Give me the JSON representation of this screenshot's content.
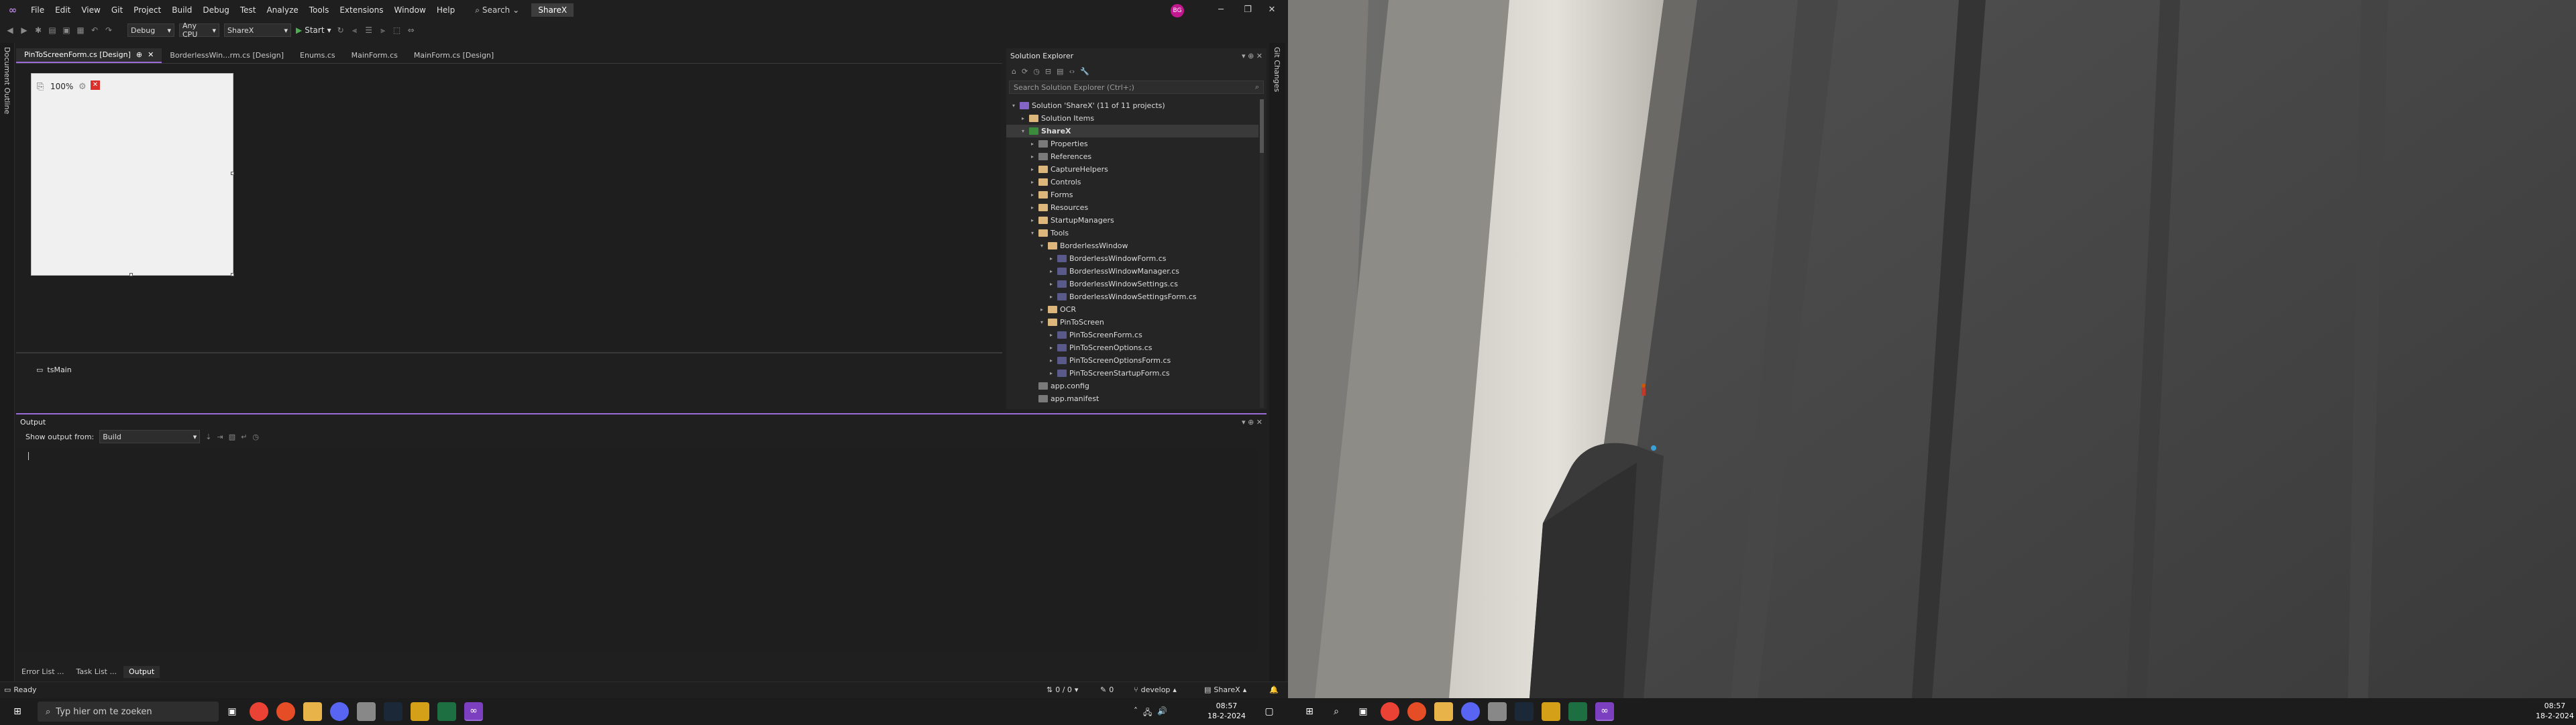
{
  "menubar": {
    "logo": "VS",
    "items": [
      "File",
      "Edit",
      "View",
      "Git",
      "Project",
      "Build",
      "Debug",
      "Test",
      "Analyze",
      "Tools",
      "Extensions",
      "Window",
      "Help"
    ],
    "search_label": "Search",
    "solution_name": "ShareX",
    "avatar_initials": "BG"
  },
  "toolbar": {
    "configuration": "Debug",
    "platform": "Any CPU",
    "startup_project": "ShareX",
    "start_label": "Start"
  },
  "left_strip": {
    "label": "Document Outline"
  },
  "right_strip": {
    "label": "Git Changes"
  },
  "doc_tabs": [
    {
      "label": "PinToScreenForm.cs [Design]",
      "active": true
    },
    {
      "label": "BorderlessWin...rm.cs [Design]",
      "active": false
    },
    {
      "label": "Enums.cs",
      "active": false
    },
    {
      "label": "MainForm.cs",
      "active": false
    },
    {
      "label": "MainForm.cs [Design]",
      "active": false
    }
  ],
  "designer": {
    "zoom": "100%",
    "tray_item": "tsMain"
  },
  "solution_explorer": {
    "title": "Solution Explorer",
    "search_placeholder": "Search Solution Explorer (Ctrl+;)",
    "items": [
      {
        "label": "Solution 'ShareX' (11 of 11 projects)",
        "type": "sln",
        "level": 0,
        "arrow": "▾"
      },
      {
        "label": "Solution Items",
        "type": "folder",
        "level": 1,
        "arrow": "▸"
      },
      {
        "label": "ShareX",
        "type": "proj",
        "level": 1,
        "arrow": "▾",
        "selected": true
      },
      {
        "label": "Properties",
        "type": "cfg",
        "level": 2,
        "arrow": "▸"
      },
      {
        "label": "References",
        "type": "cfg",
        "level": 2,
        "arrow": "▸"
      },
      {
        "label": "CaptureHelpers",
        "type": "folder",
        "level": 2,
        "arrow": "▸"
      },
      {
        "label": "Controls",
        "type": "folder",
        "level": 2,
        "arrow": "▸"
      },
      {
        "label": "Forms",
        "type": "folder",
        "level": 2,
        "arrow": "▸"
      },
      {
        "label": "Resources",
        "type": "folder",
        "level": 2,
        "arrow": "▸"
      },
      {
        "label": "StartupManagers",
        "type": "folder",
        "level": 2,
        "arrow": "▸"
      },
      {
        "label": "Tools",
        "type": "folder",
        "level": 2,
        "arrow": "▾"
      },
      {
        "label": "BorderlessWindow",
        "type": "folder",
        "level": 3,
        "arrow": "▾"
      },
      {
        "label": "BorderlessWindowForm.cs",
        "type": "cs",
        "level": 4,
        "arrow": "▸"
      },
      {
        "label": "BorderlessWindowManager.cs",
        "type": "cs",
        "level": 4,
        "arrow": "▸"
      },
      {
        "label": "BorderlessWindowSettings.cs",
        "type": "cs",
        "level": 4,
        "arrow": "▸"
      },
      {
        "label": "BorderlessWindowSettingsForm.cs",
        "type": "cs",
        "level": 4,
        "arrow": "▸"
      },
      {
        "label": "OCR",
        "type": "folder",
        "level": 3,
        "arrow": "▸"
      },
      {
        "label": "PinToScreen",
        "type": "folder",
        "level": 3,
        "arrow": "▾"
      },
      {
        "label": "PinToScreenForm.cs",
        "type": "cs",
        "level": 4,
        "arrow": "▸"
      },
      {
        "label": "PinToScreenOptions.cs",
        "type": "cs",
        "level": 4,
        "arrow": "▸"
      },
      {
        "label": "PinToScreenOptionsForm.cs",
        "type": "cs",
        "level": 4,
        "arrow": "▸"
      },
      {
        "label": "PinToScreenStartupForm.cs",
        "type": "cs",
        "level": 4,
        "arrow": "▸"
      },
      {
        "label": "app.config",
        "type": "cfg",
        "level": 2,
        "arrow": ""
      },
      {
        "label": "app.manifest",
        "type": "cfg",
        "level": 2,
        "arrow": ""
      }
    ]
  },
  "output": {
    "title": "Output",
    "show_from_label": "Show output from:",
    "source": "Build"
  },
  "bottom_tabs": [
    {
      "label": "Error List ...",
      "active": false
    },
    {
      "label": "Task List ...",
      "active": false
    },
    {
      "label": "Output",
      "active": true
    }
  ],
  "statusbar": {
    "ready": "Ready",
    "changes": "0 / 0",
    "pencil_count": "0",
    "branch": "develop",
    "repo": "ShareX"
  },
  "taskbar_left": {
    "search_placeholder": "Typ hier om te zoeken",
    "time": "08:57",
    "date": "18-2-2024"
  },
  "taskbar_right": {
    "time": "08:57",
    "date": "18-2-2024"
  },
  "colors": {
    "accent": "#9b6cd8",
    "background": "#1f1f1f",
    "panel": "#252526"
  }
}
